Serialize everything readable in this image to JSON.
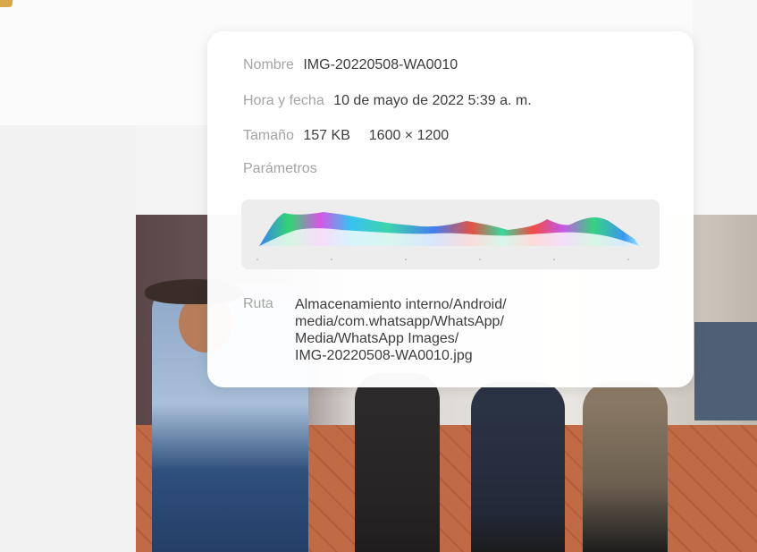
{
  "details": {
    "name_label": "Nombre",
    "name_value": "IMG-20220508-WA0010",
    "datetime_label": "Hora y fecha",
    "datetime_value": "10 de mayo de 2022 5:39 a. m.",
    "size_label": "Tamaño",
    "size_value": "157 KB",
    "resolution_value": "1600 × 1200",
    "params_label": "Parámetros",
    "path_label": "Ruta",
    "path_lines": [
      "Almacenamiento interno/Android/",
      "media/com.whatsapp/WhatsApp/",
      "Media/WhatsApp Images/",
      "IMG-20220508-WA0010.jpg"
    ]
  },
  "colors": {
    "card_bg": "#ffffff",
    "label": "#a4a4a4",
    "value": "#3c3c3c",
    "histogram_bg": "#ededed"
  }
}
